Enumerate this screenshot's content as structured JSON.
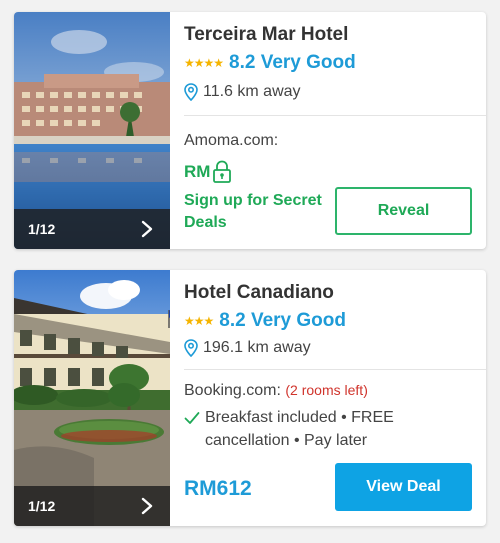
{
  "hotels": [
    {
      "name": "Terceira Mar Hotel",
      "stars": "★★★★",
      "score": "8.2 Very Good",
      "distance": "11.6 km away",
      "photo_counter": "1/12",
      "provider": "Amoma.com:",
      "currency": "RM",
      "secret_deals": "Sign up for Secret Deals",
      "action_label": "Reveal"
    },
    {
      "name": "Hotel Canadiano",
      "stars": "★★★",
      "score": "8.2 Very Good",
      "distance": "196.1 km away",
      "photo_counter": "1/12",
      "provider": "Booking.com:",
      "rooms_left": "(2 rooms left)",
      "perks": "Breakfast included • FREE cancellation • Pay later",
      "price": "RM612",
      "action_label": "View Deal"
    }
  ],
  "colors": {
    "rating_blue": "#1e9bd7",
    "star_gold": "#f5b400",
    "deal_green": "#1fa957",
    "button_blue": "#0ea3e4",
    "alert_red": "#d0342c"
  },
  "icons": {
    "location": "map-pin-icon",
    "lock": "lock-icon",
    "next": "chevron-right-icon",
    "check": "check-icon"
  }
}
